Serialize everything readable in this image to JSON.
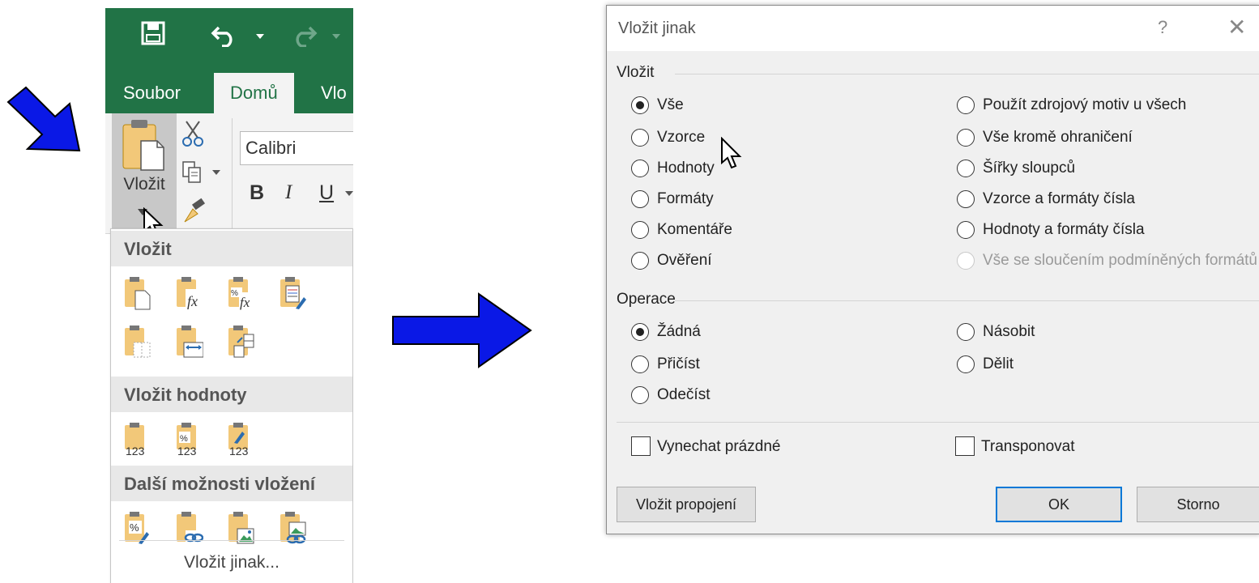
{
  "excel": {
    "tabs": {
      "file": "Soubor",
      "home": "Domů",
      "insert": "Vlo"
    },
    "paste_label": "Vložit",
    "font_name": "Calibri",
    "format_buttons": {
      "bold": "B",
      "italic": "I",
      "underline": "U"
    },
    "dropdown": {
      "section_paste": "Vložit",
      "section_values": "Vložit hodnoty",
      "section_other": "Další možnosti vložení",
      "more_link": "Vložit jinak..."
    }
  },
  "dialog": {
    "title": "Vložit jinak",
    "help": "?",
    "close": "✕",
    "paste_group": "Vložit",
    "paste_options_left": [
      "Vše",
      "Vzorce",
      "Hodnoty",
      "Formáty",
      "Komentáře",
      "Ověření"
    ],
    "paste_options_right": [
      "Použít zdrojový motiv u všech",
      "Vše kromě ohraničení",
      "Šířky sloupců",
      "Vzorce a formáty čísla",
      "Hodnoty a formáty čísla",
      "Vše se sloučením podmíněných formátů"
    ],
    "operation_group": "Operace",
    "operation_left": [
      "Žádná",
      "Přičíst",
      "Odečíst"
    ],
    "operation_right": [
      "Násobit",
      "Dělit"
    ],
    "skip_blanks": "Vynechat prázdné",
    "transpose": "Transponovat",
    "paste_link_button": "Vložit propojení",
    "ok_button": "OK",
    "cancel_button": "Storno"
  },
  "colors": {
    "excel_green": "#217346",
    "arrow_blue": "#0a18e6",
    "dialog_bg": "#f0f0f0",
    "ok_border": "#0078d7"
  }
}
